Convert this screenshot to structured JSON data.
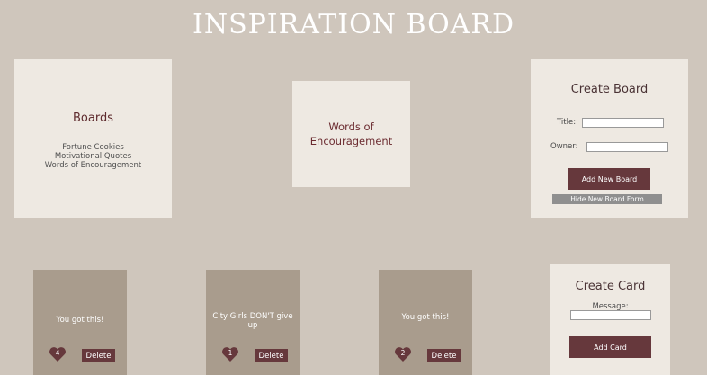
{
  "header": {
    "title": "INSPIRATION BOARD"
  },
  "boards_panel": {
    "heading": "Boards",
    "boards": [
      "Fortune Cookies",
      "Motivational Quotes",
      "Words of Encouragement"
    ]
  },
  "selected_board": {
    "title": "Words of Encouragement"
  },
  "create_board": {
    "heading": "Create Board",
    "title_label": "Title:",
    "title_value": "",
    "owner_label": "Owner:",
    "owner_value": "",
    "submit_label": "Add New Board",
    "hide_label": "Hide New Board Form"
  },
  "cards": [
    {
      "message": "You got this!",
      "likes": "4",
      "delete_label": "Delete"
    },
    {
      "message": "City Girls DON'T give up",
      "likes": "1",
      "delete_label": "Delete"
    },
    {
      "message": "You got this!",
      "likes": "2",
      "delete_label": "Delete"
    }
  ],
  "create_card": {
    "heading": "Create Card",
    "message_label": "Message:",
    "message_value": "",
    "submit_label": "Add Card"
  },
  "colors": {
    "background": "#cfc6bc",
    "panel": "#eee9e2",
    "card": "#a99c8d",
    "accent": "#66383c"
  },
  "icons": {
    "like": "heart-icon"
  }
}
